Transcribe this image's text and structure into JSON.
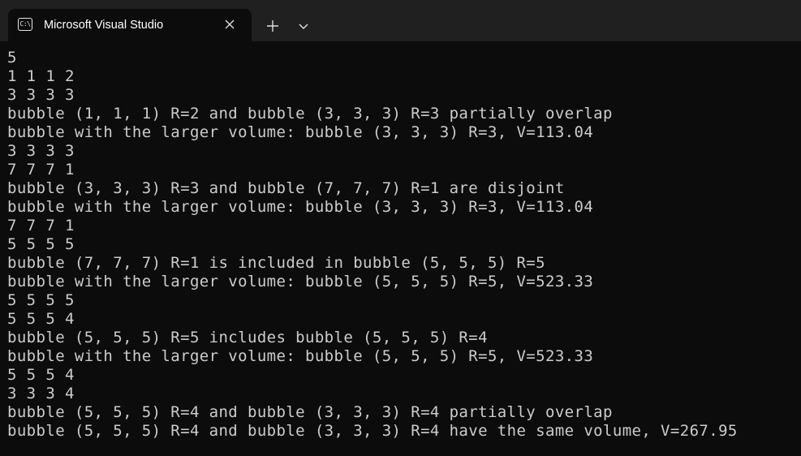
{
  "tab": {
    "title": "Microsoft Visual Studio",
    "icon": "terminal-icon",
    "icon_text": "C:\\",
    "close_icon": "close-icon"
  },
  "toolbar": {
    "new_tab_icon": "plus-icon",
    "dropdown_icon": "chevron-down-icon"
  },
  "colors": {
    "titlebar": "#202020",
    "background": "#0c0c0c",
    "text": "#cccccc"
  },
  "console": {
    "lines": [
      "5",
      "1 1 1 2",
      "3 3 3 3",
      "bubble (1, 1, 1) R=2 and bubble (3, 3, 3) R=3 partially overlap",
      "bubble with the larger volume: bubble (3, 3, 3) R=3, V=113.04",
      "3 3 3 3",
      "7 7 7 1",
      "bubble (3, 3, 3) R=3 and bubble (7, 7, 7) R=1 are disjoint",
      "bubble with the larger volume: bubble (3, 3, 3) R=3, V=113.04",
      "7 7 7 1",
      "5 5 5 5",
      "bubble (7, 7, 7) R=1 is included in bubble (5, 5, 5) R=5",
      "bubble with the larger volume: bubble (5, 5, 5) R=5, V=523.33",
      "5 5 5 5",
      "5 5 5 4",
      "bubble (5, 5, 5) R=5 includes bubble (5, 5, 5) R=4",
      "bubble with the larger volume: bubble (5, 5, 5) R=5, V=523.33",
      "5 5 5 4",
      "3 3 3 4",
      "bubble (5, 5, 5) R=4 and bubble (3, 3, 3) R=4 partially overlap",
      "bubble (5, 5, 5) R=4 and bubble (3, 3, 3) R=4 have the same volume, V=267.95"
    ]
  }
}
